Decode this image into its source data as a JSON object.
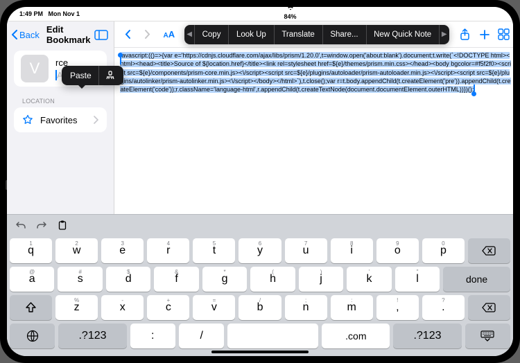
{
  "status": {
    "time": "1:49 PM",
    "date": "Mon Nov 1",
    "battery": "84%"
  },
  "left": {
    "back": "Back",
    "title": "Edit Bookmark",
    "icon_letter": "V",
    "name_value": "rce",
    "address_placeholder": "Address",
    "popover": {
      "paste": "Paste"
    },
    "location_label": "LOCATION",
    "favorites": "Favorites"
  },
  "right": {
    "aa": "AA",
    "menu": [
      "Copy",
      "Look Up",
      "Translate",
      "Share...",
      "New Quick Note"
    ],
    "code": "javascript:(()=>{var e='https://cdnjs.cloudflare.com/ajax/libs/prism/1.20.0',t=window.open('about:blank').document;t.write(`<!DOCTYPE html><html><head><title>Source of ${location.href}</title><link rel=stylesheet href=${e}/themes/prism.min.css></head><body bgcolor=#f5f2f0><script src=${e}/components/prism-core.min.js><\\/script><script src=${e}/plugins/autoloader/prism-autoloader.min.js><\\/script><script src=${e}/plugins/autolinker/prism-autolinker.min.js><\\/script></body></html>`),t.close();var r=t.body.appendChild(t.createElement('pre')).appendChild(t.createElement('code'));r.className='language-html',r.appendChild(t.createTextNode(document.documentElement.outerHTML))})();"
  },
  "kb": {
    "row1": [
      {
        "main": "q",
        "alt": "1"
      },
      {
        "main": "w",
        "alt": "2"
      },
      {
        "main": "e",
        "alt": "3"
      },
      {
        "main": "r",
        "alt": "4"
      },
      {
        "main": "t",
        "alt": "5"
      },
      {
        "main": "y",
        "alt": "6"
      },
      {
        "main": "u",
        "alt": "7"
      },
      {
        "main": "i",
        "alt": "8"
      },
      {
        "main": "o",
        "alt": "9"
      },
      {
        "main": "p",
        "alt": "0"
      }
    ],
    "row2": [
      {
        "main": "a",
        "alt": "@"
      },
      {
        "main": "s",
        "alt": "#"
      },
      {
        "main": "d",
        "alt": "$"
      },
      {
        "main": "f",
        "alt": "&"
      },
      {
        "main": "g",
        "alt": "*"
      },
      {
        "main": "h",
        "alt": "("
      },
      {
        "main": "j",
        "alt": ")"
      },
      {
        "main": "k",
        "alt": "'"
      },
      {
        "main": "l",
        "alt": "\""
      }
    ],
    "row3": [
      {
        "main": "z",
        "alt": "%"
      },
      {
        "main": "x",
        "alt": "-"
      },
      {
        "main": "c",
        "alt": "+"
      },
      {
        "main": "v",
        "alt": "="
      },
      {
        "main": "b",
        "alt": "/"
      },
      {
        "main": "n",
        "alt": ";"
      },
      {
        "main": "m",
        "alt": ":"
      },
      {
        "main": ",",
        "alt": "!"
      },
      {
        "main": ".",
        "alt": "?"
      }
    ],
    "sym": ".?123",
    "done": "done",
    "punct": [
      ":",
      "/",
      ".com"
    ]
  }
}
